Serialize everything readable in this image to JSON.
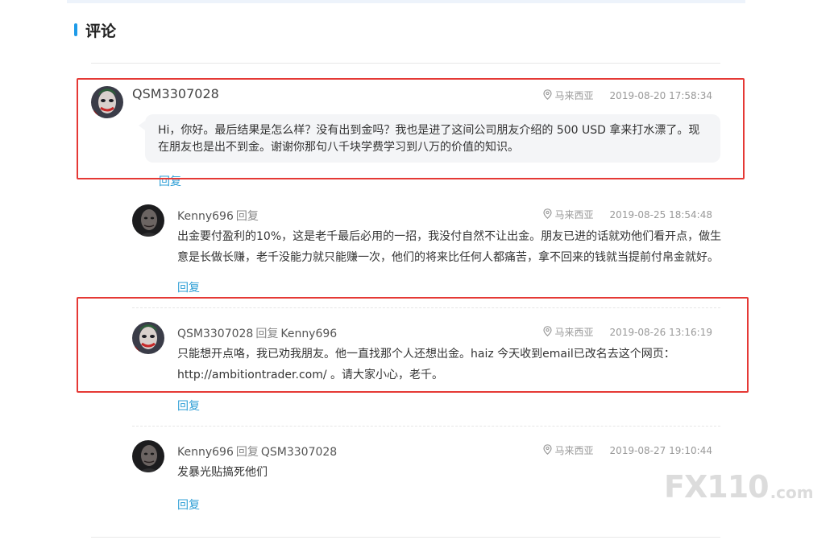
{
  "section": {
    "title": "评论"
  },
  "comments": [
    {
      "user": "QSM3307028",
      "location": "马来西亚",
      "time": "2019-08-20 17:58:34",
      "text": "Hi，你好。最后结果是怎么样？没有出到金吗？我也是进了这间公司朋友介绍的 500 USD 拿来打水漂了。现在朋友也是出不到金。谢谢你那句八千块学费学习到八万的价值的知识。",
      "reply_label": "回复"
    }
  ],
  "replies": [
    {
      "user": "Kenny696",
      "reply_word": "回复",
      "target": "",
      "location": "马来西亚",
      "time": "2019-08-25 18:54:48",
      "text": "出金要付盈利的10%，这是老千最后必用的一招，我没付自然不让出金。朋友已进的话就劝他们看开点，做生意是长做长赚，老千没能力就只能赚一次，他们的将来比任何人都痛苦，拿不回来的钱就当提前付帛金就好。",
      "reply_label": "回复"
    },
    {
      "user": "QSM3307028",
      "reply_word": "回复",
      "target": "Kenny696",
      "location": "马来西亚",
      "time": "2019-08-26 13:16:19",
      "text": "只能想开点咯，我已劝我朋友。他一直找那个人还想出金。haiz 今天收到email已改名去这个网页：http://ambitiontrader.com/ 。请大家小心，老千。",
      "reply_label": "回复"
    },
    {
      "user": "Kenny696",
      "reply_word": "回复",
      "target": "QSM3307028",
      "location": "马来西亚",
      "time": "2019-08-27 19:10:44",
      "text": "发暴光贴搞死他们",
      "reply_label": "回复"
    }
  ],
  "watermark": {
    "main": "FX110",
    "sub": ".com"
  },
  "colors": {
    "accent": "#1e9be8",
    "link": "#2f9fd6",
    "highlight": "#e53935"
  }
}
